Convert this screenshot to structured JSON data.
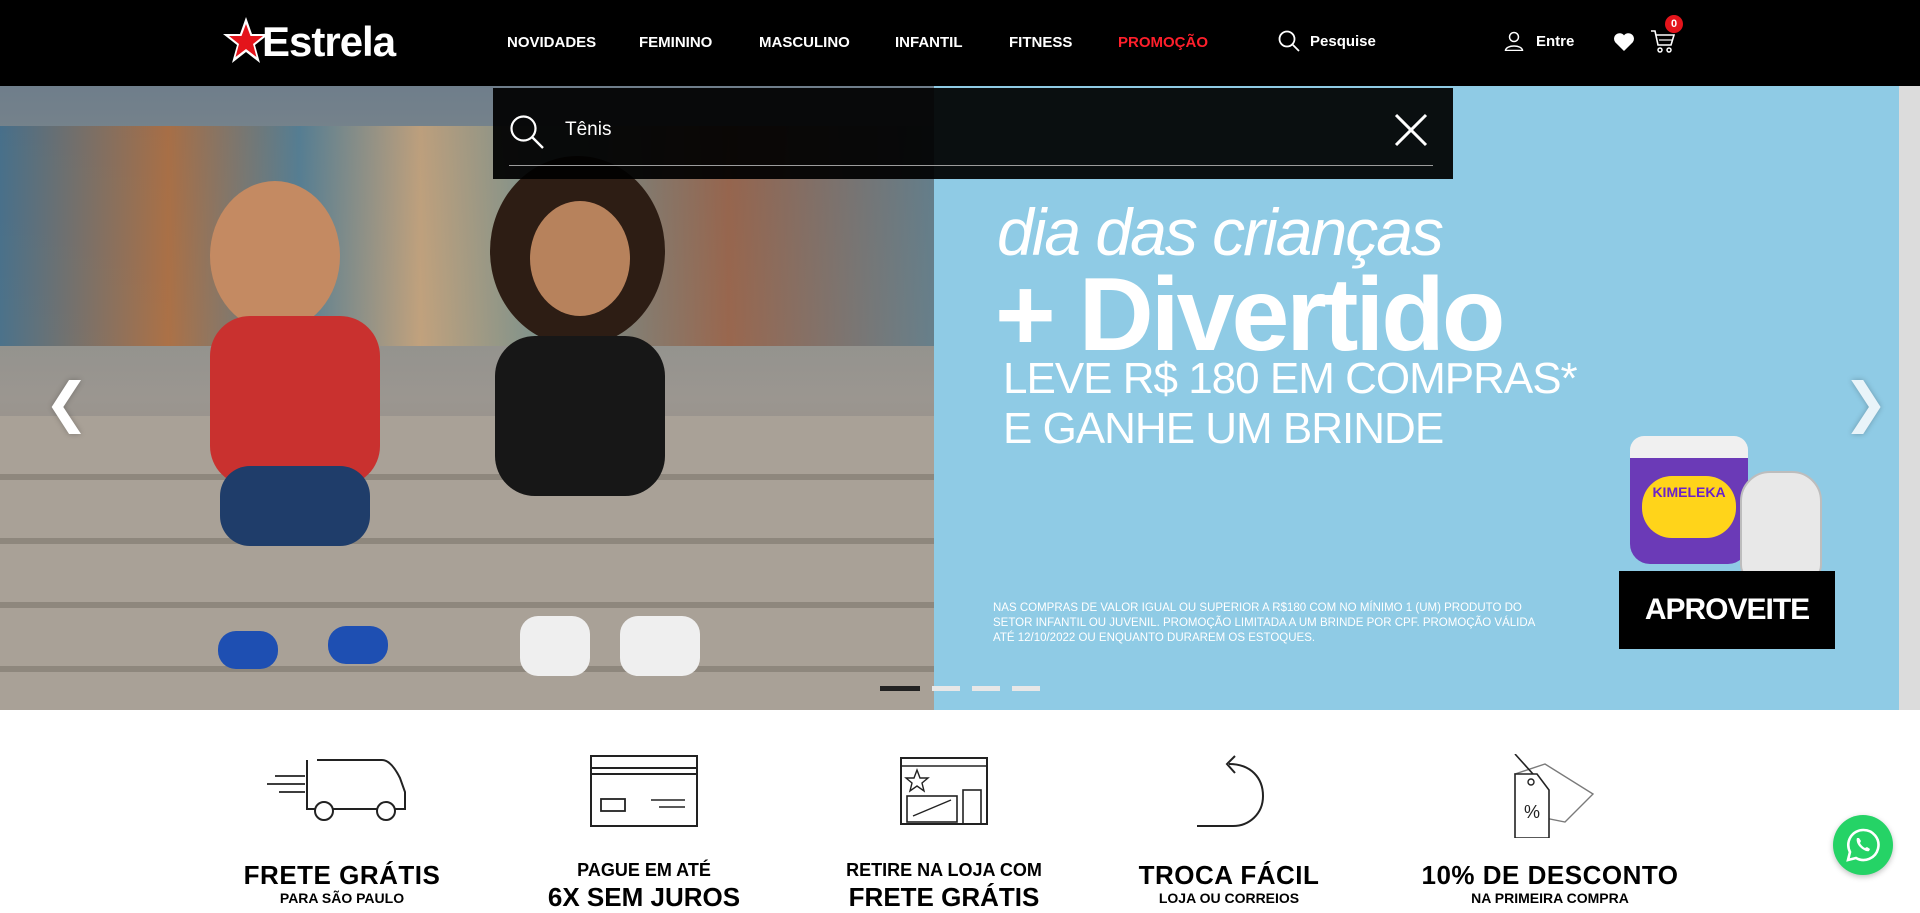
{
  "brand": {
    "name": "Estrela",
    "accent": "#e4141b"
  },
  "nav": {
    "items": [
      "NOVIDADES",
      "FEMININO",
      "MASCULINO",
      "INFANTIL",
      "FITNESS",
      "PROMOÇÃO"
    ],
    "promo_color": "#ff1f2b"
  },
  "header": {
    "search_label": "Pesquise",
    "login_label": "Entre",
    "cart_count": "0"
  },
  "search": {
    "value": "Tênis"
  },
  "banner": {
    "line1": "dia das crianças",
    "line2": "+ Divertido",
    "line3a": "LEVE R$ 180 EM COMPRAS*",
    "line3b": "E GANHE UM BRINDE",
    "fine_print": "NAS COMPRAS DE VALOR IGUAL OU SUPERIOR A R$180 COM NO MÍNIMO 1 (UM) PRODUTO DO SETOR INFANTIL OU JUVENIL. PROMOÇÃO LIMITADA A UM BRINDE POR CPF. PROMOÇÃO VÁLIDA ATÉ 12/10/2022 OU ENQUANTO DURAREM OS ESTOQUES.",
    "product_label": "KIMELEKA",
    "cta": "APROVEITE",
    "slides": 4,
    "active_slide": 1,
    "background": "#8fcbe5"
  },
  "features": [
    {
      "icon": "delivery-truck-icon",
      "title": "FRETE GRÁTIS",
      "sub": "PARA SÃO PAULO"
    },
    {
      "icon": "credit-card-icon",
      "title": "PAGUE EM ATÉ",
      "sub": "6X SEM JUROS"
    },
    {
      "icon": "store-pickup-icon",
      "title": "RETIRE NA LOJA COM",
      "sub": "FRETE GRÁTIS"
    },
    {
      "icon": "return-arrow-icon",
      "title": "TROCA FÁCIL",
      "sub": "LOJA OU CORREIOS"
    },
    {
      "icon": "discount-tag-icon",
      "title": "10% DE DESCONTO",
      "sub": "NA PRIMEIRA COMPRA"
    }
  ]
}
